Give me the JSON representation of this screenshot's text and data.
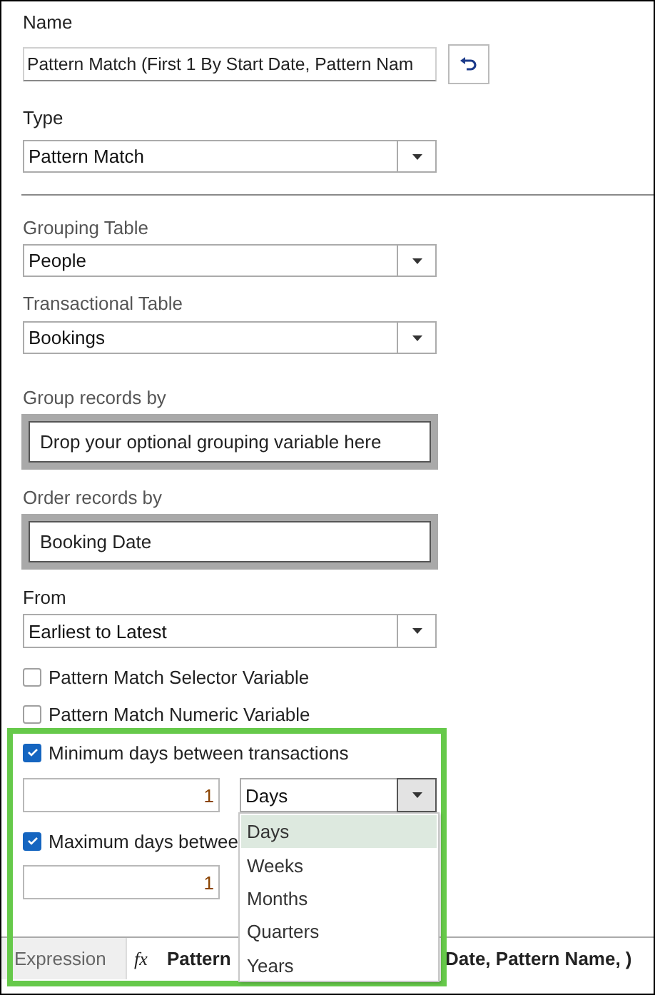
{
  "name_field": {
    "label": "Name",
    "value": "Pattern Match (First 1 By Start Date, Pattern Nam"
  },
  "type_field": {
    "label": "Type",
    "value": "Pattern Match"
  },
  "grouping_table": {
    "label": "Grouping Table",
    "value": "People"
  },
  "transactional_table": {
    "label": "Transactional Table",
    "value": "Bookings"
  },
  "group_records_by": {
    "label": "Group records by",
    "hint": "Drop your optional grouping variable here"
  },
  "order_records_by": {
    "label": "Order records by",
    "value": "Booking Date"
  },
  "from_field": {
    "label": "From",
    "value": "Earliest to Latest"
  },
  "options": [
    {
      "label": "Pattern Match Selector Variable",
      "checked": false
    },
    {
      "label": "Pattern Match Numeric Variable",
      "checked": false
    }
  ],
  "minimum": {
    "label": "Minimum days between transactions",
    "checked": true,
    "value": "1",
    "unit": "Days",
    "unit_open": true
  },
  "maximum": {
    "label": "Maximum days betwee",
    "checked": true,
    "value": "1"
  },
  "unit_list": [
    {
      "label": "Days",
      "selected": true
    },
    {
      "label": "Weeks",
      "selected": false
    },
    {
      "label": "Months",
      "selected": false
    },
    {
      "label": "Quarters",
      "selected": false
    },
    {
      "label": "Years",
      "selected": false
    }
  ],
  "expression_bar": {
    "tab": "Expression",
    "fx": "fx",
    "text_start": "Pattern",
    "text_end": "Date, Pattern Name, )"
  },
  "annotation": {
    "kind": "highlight-frame"
  }
}
